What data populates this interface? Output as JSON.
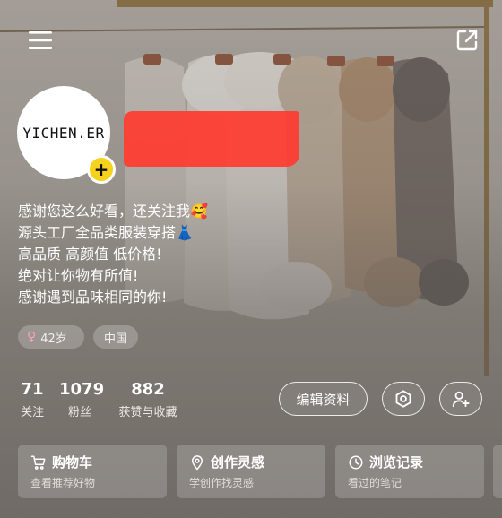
{
  "header": {
    "menu_icon": "hamburger-menu-icon",
    "share_icon": "share-external-icon"
  },
  "profile": {
    "avatar_text": "YICHEN.ER",
    "add_badge": "+"
  },
  "bio": {
    "lines": [
      "感谢您这么好看，还关注我🥰",
      "源头工厂全品类服装穿搭👗",
      "高品质 高颜值 低价格!",
      "绝对让你物有所值!",
      "感谢遇到品味相同的你!"
    ]
  },
  "tags": {
    "gender_icon": "female-icon",
    "age": "42岁",
    "region": "中国"
  },
  "stats": {
    "following": {
      "value": "71",
      "label": "关注"
    },
    "fans": {
      "value": "1079",
      "label": "粉丝"
    },
    "likes": {
      "value": "882",
      "label": "获赞与收藏"
    }
  },
  "actions": {
    "edit_profile": "编辑资料",
    "settings_icon": "gear-icon",
    "add_friend_icon": "add-user-icon"
  },
  "cards": [
    {
      "title": "购物车",
      "subtitle": "查看推荐好物",
      "icon": "cart-icon"
    },
    {
      "title": "创作灵感",
      "subtitle": "学创作找灵感",
      "icon": "location-pin-icon"
    },
    {
      "title": "浏览记录",
      "subtitle": "看过的笔记",
      "icon": "clock-icon"
    }
  ],
  "colors": {
    "badge_yellow": "#f6d21c",
    "redaction_red": "#ff3b30",
    "female_pink": "#f5a6b8"
  }
}
